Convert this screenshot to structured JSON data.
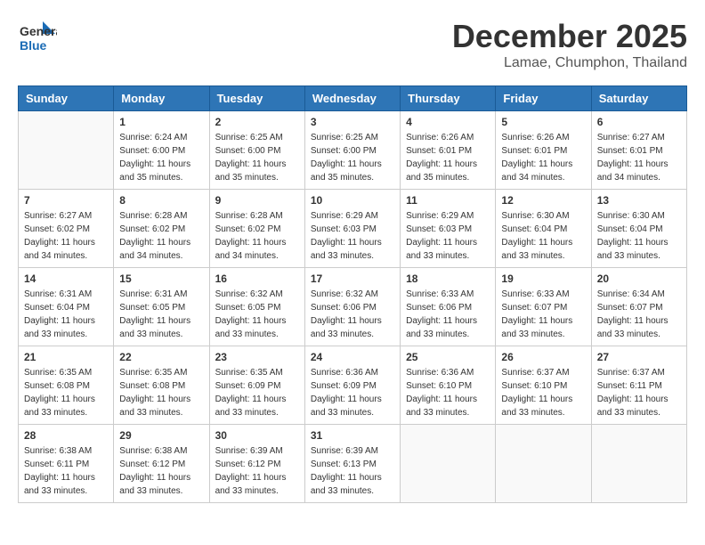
{
  "header": {
    "logo_line1": "General",
    "logo_line2": "Blue",
    "month": "December 2025",
    "location": "Lamae, Chumphon, Thailand"
  },
  "weekdays": [
    "Sunday",
    "Monday",
    "Tuesday",
    "Wednesday",
    "Thursday",
    "Friday",
    "Saturday"
  ],
  "weeks": [
    [
      {
        "day": "",
        "sunrise": "",
        "sunset": "",
        "daylight": ""
      },
      {
        "day": "1",
        "sunrise": "Sunrise: 6:24 AM",
        "sunset": "Sunset: 6:00 PM",
        "daylight": "Daylight: 11 hours and 35 minutes."
      },
      {
        "day": "2",
        "sunrise": "Sunrise: 6:25 AM",
        "sunset": "Sunset: 6:00 PM",
        "daylight": "Daylight: 11 hours and 35 minutes."
      },
      {
        "day": "3",
        "sunrise": "Sunrise: 6:25 AM",
        "sunset": "Sunset: 6:00 PM",
        "daylight": "Daylight: 11 hours and 35 minutes."
      },
      {
        "day": "4",
        "sunrise": "Sunrise: 6:26 AM",
        "sunset": "Sunset: 6:01 PM",
        "daylight": "Daylight: 11 hours and 35 minutes."
      },
      {
        "day": "5",
        "sunrise": "Sunrise: 6:26 AM",
        "sunset": "Sunset: 6:01 PM",
        "daylight": "Daylight: 11 hours and 34 minutes."
      },
      {
        "day": "6",
        "sunrise": "Sunrise: 6:27 AM",
        "sunset": "Sunset: 6:01 PM",
        "daylight": "Daylight: 11 hours and 34 minutes."
      }
    ],
    [
      {
        "day": "7",
        "sunrise": "Sunrise: 6:27 AM",
        "sunset": "Sunset: 6:02 PM",
        "daylight": "Daylight: 11 hours and 34 minutes."
      },
      {
        "day": "8",
        "sunrise": "Sunrise: 6:28 AM",
        "sunset": "Sunset: 6:02 PM",
        "daylight": "Daylight: 11 hours and 34 minutes."
      },
      {
        "day": "9",
        "sunrise": "Sunrise: 6:28 AM",
        "sunset": "Sunset: 6:02 PM",
        "daylight": "Daylight: 11 hours and 34 minutes."
      },
      {
        "day": "10",
        "sunrise": "Sunrise: 6:29 AM",
        "sunset": "Sunset: 6:03 PM",
        "daylight": "Daylight: 11 hours and 33 minutes."
      },
      {
        "day": "11",
        "sunrise": "Sunrise: 6:29 AM",
        "sunset": "Sunset: 6:03 PM",
        "daylight": "Daylight: 11 hours and 33 minutes."
      },
      {
        "day": "12",
        "sunrise": "Sunrise: 6:30 AM",
        "sunset": "Sunset: 6:04 PM",
        "daylight": "Daylight: 11 hours and 33 minutes."
      },
      {
        "day": "13",
        "sunrise": "Sunrise: 6:30 AM",
        "sunset": "Sunset: 6:04 PM",
        "daylight": "Daylight: 11 hours and 33 minutes."
      }
    ],
    [
      {
        "day": "14",
        "sunrise": "Sunrise: 6:31 AM",
        "sunset": "Sunset: 6:04 PM",
        "daylight": "Daylight: 11 hours and 33 minutes."
      },
      {
        "day": "15",
        "sunrise": "Sunrise: 6:31 AM",
        "sunset": "Sunset: 6:05 PM",
        "daylight": "Daylight: 11 hours and 33 minutes."
      },
      {
        "day": "16",
        "sunrise": "Sunrise: 6:32 AM",
        "sunset": "Sunset: 6:05 PM",
        "daylight": "Daylight: 11 hours and 33 minutes."
      },
      {
        "day": "17",
        "sunrise": "Sunrise: 6:32 AM",
        "sunset": "Sunset: 6:06 PM",
        "daylight": "Daylight: 11 hours and 33 minutes."
      },
      {
        "day": "18",
        "sunrise": "Sunrise: 6:33 AM",
        "sunset": "Sunset: 6:06 PM",
        "daylight": "Daylight: 11 hours and 33 minutes."
      },
      {
        "day": "19",
        "sunrise": "Sunrise: 6:33 AM",
        "sunset": "Sunset: 6:07 PM",
        "daylight": "Daylight: 11 hours and 33 minutes."
      },
      {
        "day": "20",
        "sunrise": "Sunrise: 6:34 AM",
        "sunset": "Sunset: 6:07 PM",
        "daylight": "Daylight: 11 hours and 33 minutes."
      }
    ],
    [
      {
        "day": "21",
        "sunrise": "Sunrise: 6:35 AM",
        "sunset": "Sunset: 6:08 PM",
        "daylight": "Daylight: 11 hours and 33 minutes."
      },
      {
        "day": "22",
        "sunrise": "Sunrise: 6:35 AM",
        "sunset": "Sunset: 6:08 PM",
        "daylight": "Daylight: 11 hours and 33 minutes."
      },
      {
        "day": "23",
        "sunrise": "Sunrise: 6:35 AM",
        "sunset": "Sunset: 6:09 PM",
        "daylight": "Daylight: 11 hours and 33 minutes."
      },
      {
        "day": "24",
        "sunrise": "Sunrise: 6:36 AM",
        "sunset": "Sunset: 6:09 PM",
        "daylight": "Daylight: 11 hours and 33 minutes."
      },
      {
        "day": "25",
        "sunrise": "Sunrise: 6:36 AM",
        "sunset": "Sunset: 6:10 PM",
        "daylight": "Daylight: 11 hours and 33 minutes."
      },
      {
        "day": "26",
        "sunrise": "Sunrise: 6:37 AM",
        "sunset": "Sunset: 6:10 PM",
        "daylight": "Daylight: 11 hours and 33 minutes."
      },
      {
        "day": "27",
        "sunrise": "Sunrise: 6:37 AM",
        "sunset": "Sunset: 6:11 PM",
        "daylight": "Daylight: 11 hours and 33 minutes."
      }
    ],
    [
      {
        "day": "28",
        "sunrise": "Sunrise: 6:38 AM",
        "sunset": "Sunset: 6:11 PM",
        "daylight": "Daylight: 11 hours and 33 minutes."
      },
      {
        "day": "29",
        "sunrise": "Sunrise: 6:38 AM",
        "sunset": "Sunset: 6:12 PM",
        "daylight": "Daylight: 11 hours and 33 minutes."
      },
      {
        "day": "30",
        "sunrise": "Sunrise: 6:39 AM",
        "sunset": "Sunset: 6:12 PM",
        "daylight": "Daylight: 11 hours and 33 minutes."
      },
      {
        "day": "31",
        "sunrise": "Sunrise: 6:39 AM",
        "sunset": "Sunset: 6:13 PM",
        "daylight": "Daylight: 11 hours and 33 minutes."
      },
      {
        "day": "",
        "sunrise": "",
        "sunset": "",
        "daylight": ""
      },
      {
        "day": "",
        "sunrise": "",
        "sunset": "",
        "daylight": ""
      },
      {
        "day": "",
        "sunrise": "",
        "sunset": "",
        "daylight": ""
      }
    ]
  ]
}
